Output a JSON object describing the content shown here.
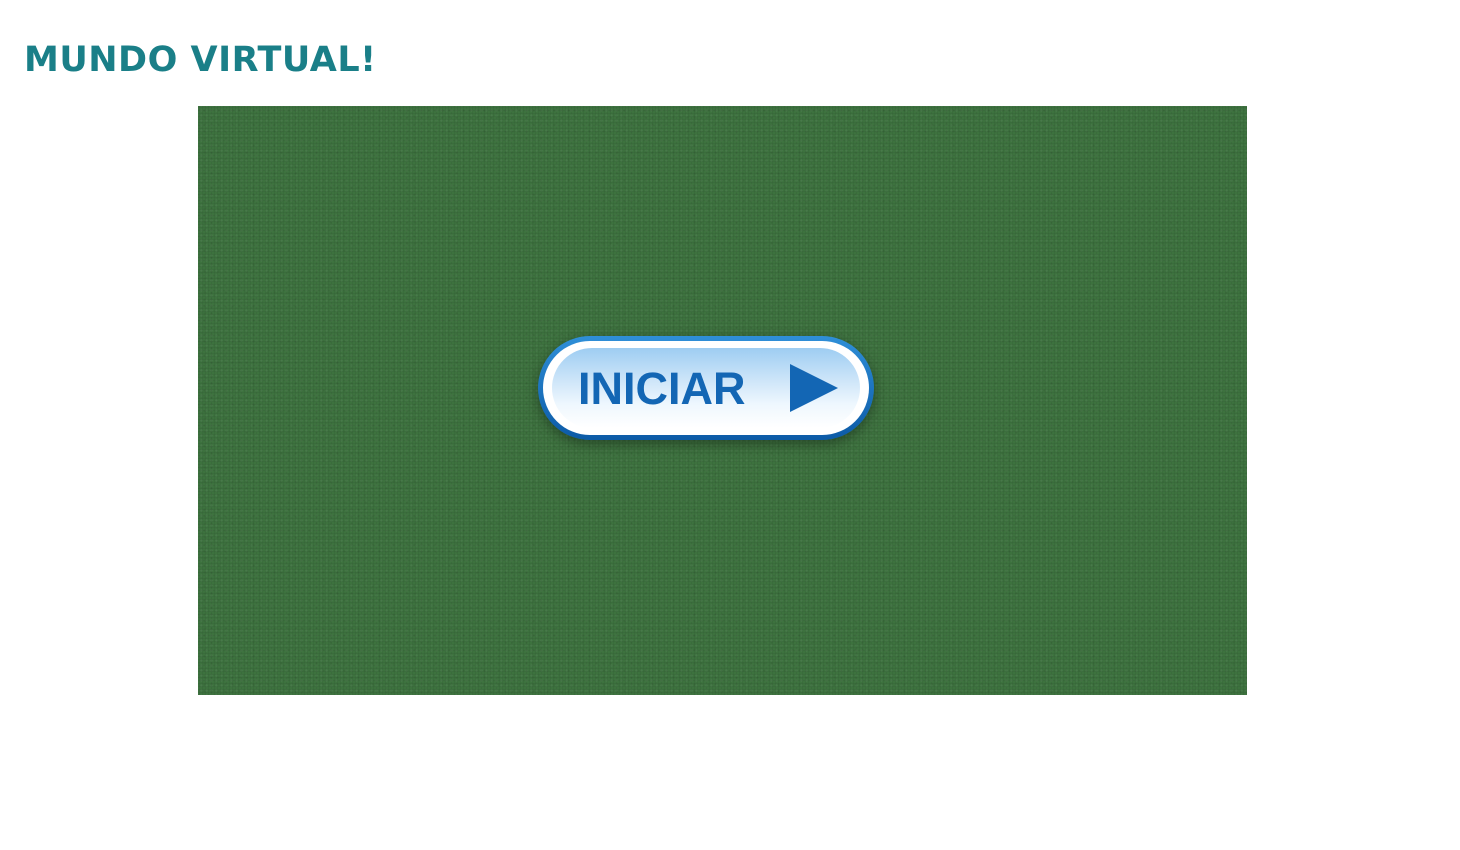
{
  "page": {
    "title": "MUNDO VIRTUAL!"
  },
  "game": {
    "start_button_label": "INICIAR",
    "start_button_icon": "play-triangle-icon"
  },
  "colors": {
    "title": "#1a7f88",
    "canvas_background": "#3e7440",
    "button_border": "#1366b4",
    "button_text": "#1366b4"
  }
}
